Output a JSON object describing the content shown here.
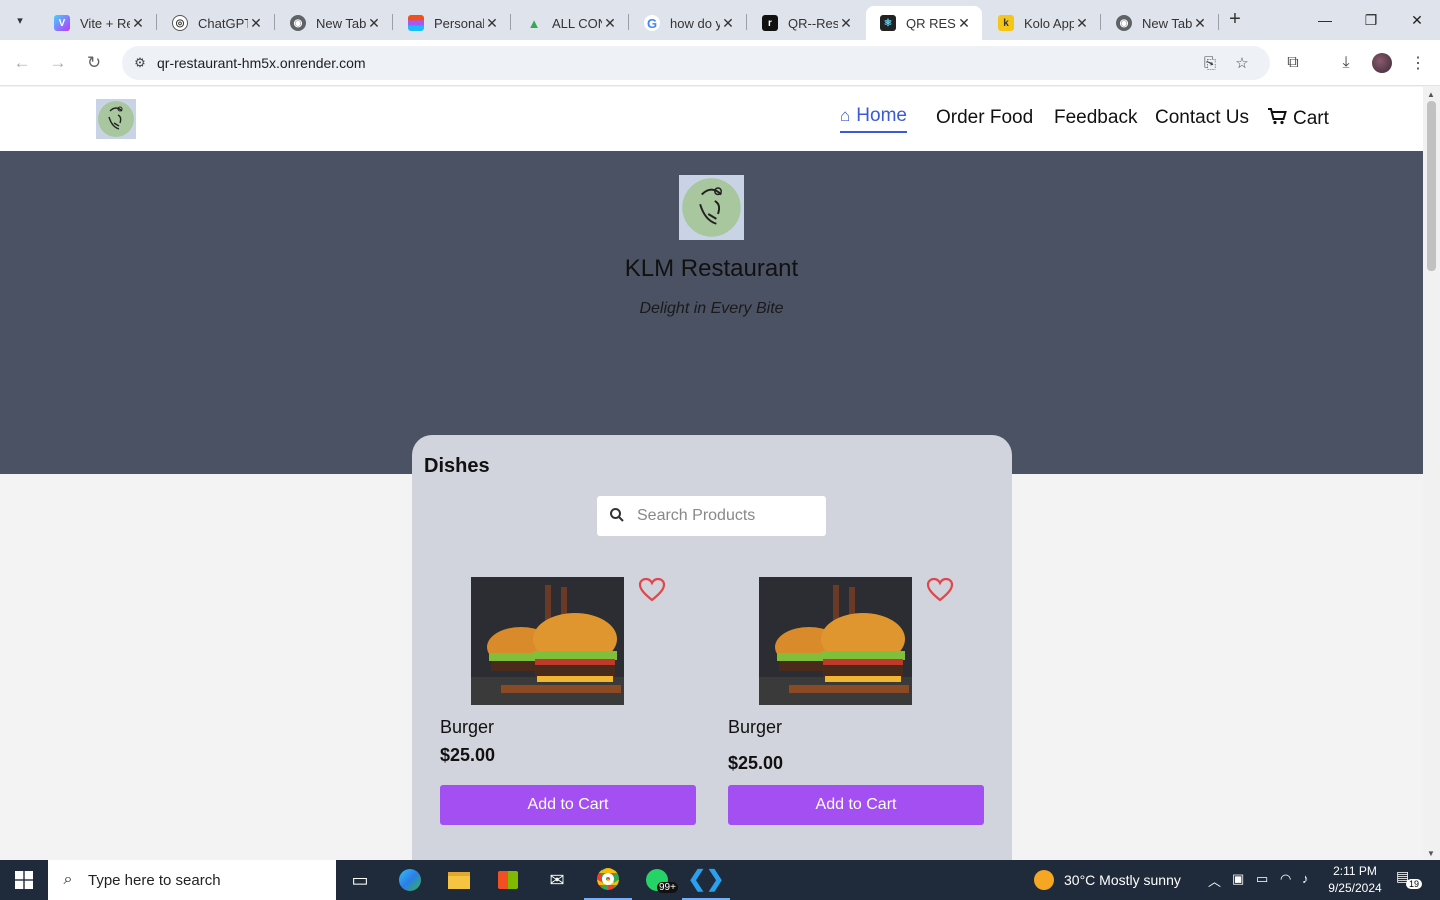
{
  "browser": {
    "tabs": [
      {
        "label": "Vite + React",
        "favicon": "vite-icon",
        "active": false
      },
      {
        "label": "ChatGPT",
        "favicon": "chatgpt-icon",
        "active": false
      },
      {
        "label": "New Tab",
        "favicon": "chrome-icon",
        "active": false
      },
      {
        "label": "Personal",
        "favicon": "figma-icon",
        "active": false
      },
      {
        "label": "ALL CONTENT",
        "favicon": "drive-icon",
        "active": false
      },
      {
        "label": "how do you",
        "favicon": "google-icon",
        "active": false
      },
      {
        "label": "QR--Restaurant",
        "favicon": "render-icon",
        "active": false
      },
      {
        "label": "QR RESTAURANT",
        "favicon": "react-icon",
        "active": true
      },
      {
        "label": "Kolo App",
        "favicon": "kolo-icon",
        "active": false
      },
      {
        "label": "New Tab",
        "favicon": "chrome-icon",
        "active": false
      }
    ],
    "url": "qr-restaurant-hm5x.onrender.com"
  },
  "site": {
    "nav": {
      "home": "Home",
      "order_food": "Order Food",
      "feedback": "Feedback",
      "contact": "Contact Us",
      "cart": "Cart"
    },
    "hero": {
      "title": "KLM Restaurant",
      "tagline": "Delight in Every Bite"
    },
    "dishes": {
      "heading": "Dishes",
      "search_placeholder": "Search Products",
      "items": [
        {
          "name": "Burger",
          "price": "$25.00",
          "button": "Add to Cart"
        },
        {
          "name": "Burger",
          "price": "$25.00",
          "button": "Add to Cart"
        }
      ]
    }
  },
  "colors": {
    "accent_button": "#a34ff2",
    "hero_bg": "#4a5263",
    "nav_active": "#3b5bd6",
    "heart": "#e0474c"
  },
  "taskbar": {
    "search_placeholder": "Type here to search",
    "weather": "30°C  Mostly sunny",
    "time": "2:11 PM",
    "date": "9/25/2024",
    "whatsapp_badge": "99+",
    "notification_count": "19"
  }
}
